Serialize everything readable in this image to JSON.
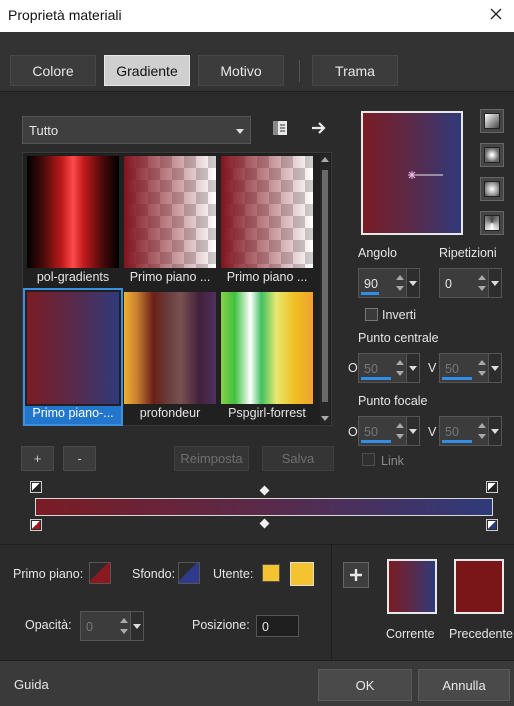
{
  "window": {
    "title": "Proprietà materiali"
  },
  "tabs": [
    {
      "label": "Colore"
    },
    {
      "label": "Gradiente"
    },
    {
      "label": "Motivo"
    },
    {
      "label": "Trama"
    }
  ],
  "category": {
    "selected": "Tutto"
  },
  "gallery": [
    {
      "label": "pol-gradients"
    },
    {
      "label": "Primo piano ..."
    },
    {
      "label": "Primo piano ..."
    },
    {
      "label": "Primo piano-..."
    },
    {
      "label": "profondeur"
    },
    {
      "label": "Pspgirl-forrest"
    }
  ],
  "list_buttons": {
    "add": "+",
    "remove": "-",
    "reset": "Reimposta",
    "save": "Salva"
  },
  "angle": {
    "label": "Angolo",
    "value": "90"
  },
  "repeats": {
    "label": "Ripetizioni",
    "value": "0"
  },
  "invert": {
    "label": "Inverti"
  },
  "center_point": {
    "label": "Punto centrale",
    "o_label": "O",
    "v_label": "V",
    "o_value": "50",
    "v_value": "50"
  },
  "focal_point": {
    "label": "Punto focale",
    "o_label": "O",
    "v_label": "V",
    "o_value": "50",
    "v_value": "50"
  },
  "link": {
    "label": "Link"
  },
  "bottom": {
    "foreground_label": "Primo piano:",
    "background_label": "Sfondo:",
    "user_label": "Utente:",
    "opacity_label": "Opacità:",
    "opacity_value": "0",
    "position_label": "Posizione:",
    "position_value": "0",
    "current_label": "Corrente",
    "previous_label": "Precedente"
  },
  "colors": {
    "accent": "#2f8fe8",
    "gradient_start": "#7a1c24",
    "gradient_end": "#2f3a7a",
    "user_yellow": "#f4c430",
    "previous_red": "#7a1518"
  },
  "footer": {
    "help": "Guida",
    "ok": "OK",
    "cancel": "Annulla"
  }
}
